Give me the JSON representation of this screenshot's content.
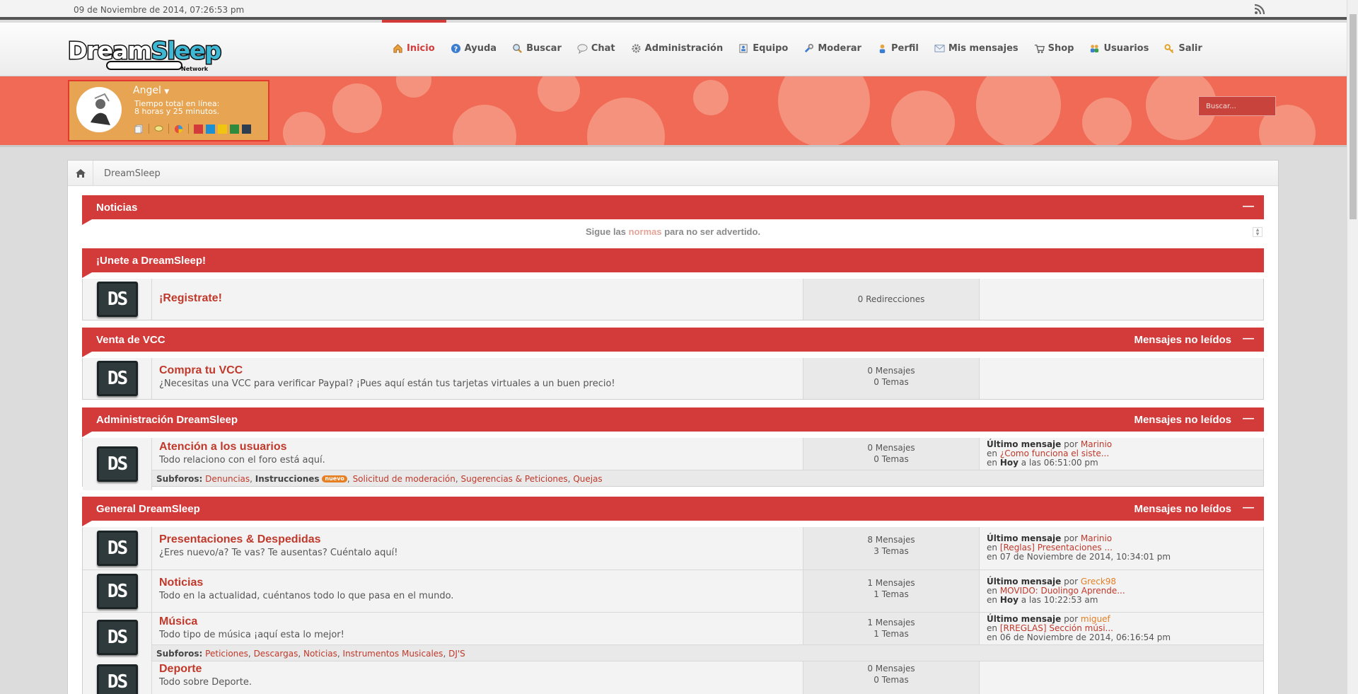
{
  "topbar": {
    "datetime": "09 de Noviembre de 2014, 07:26:53 pm"
  },
  "logo": {
    "part1": "Dream",
    "part2": "Sleep",
    "sub": "Network"
  },
  "nav": [
    {
      "label": "Inicio",
      "icon": "home-icon"
    },
    {
      "label": "Ayuda",
      "icon": "help-icon"
    },
    {
      "label": "Buscar",
      "icon": "search-icon"
    },
    {
      "label": "Chat",
      "icon": "chat-icon"
    },
    {
      "label": "Administración",
      "icon": "gear-icon"
    },
    {
      "label": "Equipo",
      "icon": "team-icon"
    },
    {
      "label": "Moderar",
      "icon": "wrench-icon"
    },
    {
      "label": "Perfil",
      "icon": "user-icon"
    },
    {
      "label": "Mis mensajes",
      "icon": "mail-icon"
    },
    {
      "label": "Shop",
      "icon": "cart-icon"
    },
    {
      "label": "Usuarios",
      "icon": "users-icon"
    },
    {
      "label": "Salir",
      "icon": "key-icon"
    }
  ],
  "user": {
    "name": "Angel",
    "online_label": "Tiempo total en línea:",
    "online_time": "8 horas y 25 minutos.",
    "theme_colors": [
      "#d33b3b",
      "#1e8fd0",
      "#f1c40f",
      "#2e8b3e",
      "#2c3e50"
    ]
  },
  "search": {
    "placeholder": "Buscar..."
  },
  "breadcrumb": {
    "label": "DreamSleep"
  },
  "colors": {
    "accent": "#d33b3b",
    "link": "#c0392b"
  },
  "categories": {
    "noticias": {
      "title": "Noticias",
      "dash": "—",
      "notice_pre": "Sigue las",
      "notice_link": "normas",
      "notice_post": "para no ser advertido."
    },
    "unete": {
      "title": "¡Unete a DreamSleep!"
    },
    "vcc": {
      "title": "Venta de VCC",
      "right": "Mensajes no leídos",
      "dash": "—"
    },
    "admin": {
      "title": "Administración DreamSleep",
      "right": "Mensajes no leídos",
      "dash": "—"
    },
    "general": {
      "title": "General DreamSleep",
      "right": "Mensajes no leídos",
      "dash": "—"
    }
  },
  "forums": {
    "registrate": {
      "title": "¡Registrate!",
      "stat1": "0 Redirecciones"
    },
    "vcc": {
      "title": "Compra tu VCC",
      "desc": "¿Necesitas una VCC para verificar Paypal? ¡Pues aquí están tus tarjetas virtuales a un buen precio!",
      "stat1": "0 Mensajes",
      "stat2": "0 Temas"
    },
    "atencion": {
      "title": "Atención a los usuarios",
      "desc": "Todo relaciono con el foro está aquí.",
      "stat1": "0 Mensajes",
      "stat2": "0 Temas",
      "last_label": "Último mensaje",
      "by": "por",
      "user": "Marinio",
      "in": "en",
      "topic": "¿Como funciona el siste...",
      "date_bold": "Hoy",
      "date_rest": "a las 06:51:00 pm",
      "sub_label": "Subforos:",
      "subs": [
        "Denuncias",
        "Instrucciones",
        "Solicitud de moderación",
        "Sugerencias & Peticiones",
        "Quejas"
      ],
      "badge": "nuevo"
    },
    "presentaciones": {
      "title": "Presentaciones & Despedidas",
      "desc": "¿Eres nuevo/a? Te vas? Te ausentas? Cuéntalo aquí!",
      "stat1": "8 Mensajes",
      "stat2": "3 Temas",
      "last_label": "Último mensaje",
      "by": "por",
      "user": "Marinio",
      "in": "en",
      "topic": "[Reglas] Presentaciones ...",
      "date_rest": "07 de Noviembre de 2014, 10:34:01 pm"
    },
    "noticias": {
      "title": "Noticias",
      "desc": "Todo en la actualidad, cuéntanos todo lo que pasa en el mundo.",
      "stat1": "1 Mensajes",
      "stat2": "1 Temas",
      "last_label": "Último mensaje",
      "by": "por",
      "user": "Greck98",
      "in": "en",
      "topic": "MOVIDO: Duolingo Aprende...",
      "date_bold": "Hoy",
      "date_rest": "a las 10:22:53 am"
    },
    "musica": {
      "title": "Música",
      "desc": "Todo tipo de música ¡aquí esta lo mejor!",
      "stat1": "1 Mensajes",
      "stat2": "1 Temas",
      "last_label": "Último mensaje",
      "by": "por",
      "user": "miguef",
      "in": "en",
      "topic": "[RREGLAS] Sección músi...",
      "date_rest": "06 de Noviembre de 2014, 06:16:54 pm",
      "sub_label": "Subforos:",
      "subs": [
        "Peticiones",
        "Descargas",
        "Noticias",
        "Instrumentos Musicales",
        "DJ'S"
      ]
    },
    "deporte": {
      "title": "Deporte",
      "desc": "Todo sobre Deporte.",
      "stat1": "0 Mensajes",
      "stat2": "0 Temas"
    }
  }
}
